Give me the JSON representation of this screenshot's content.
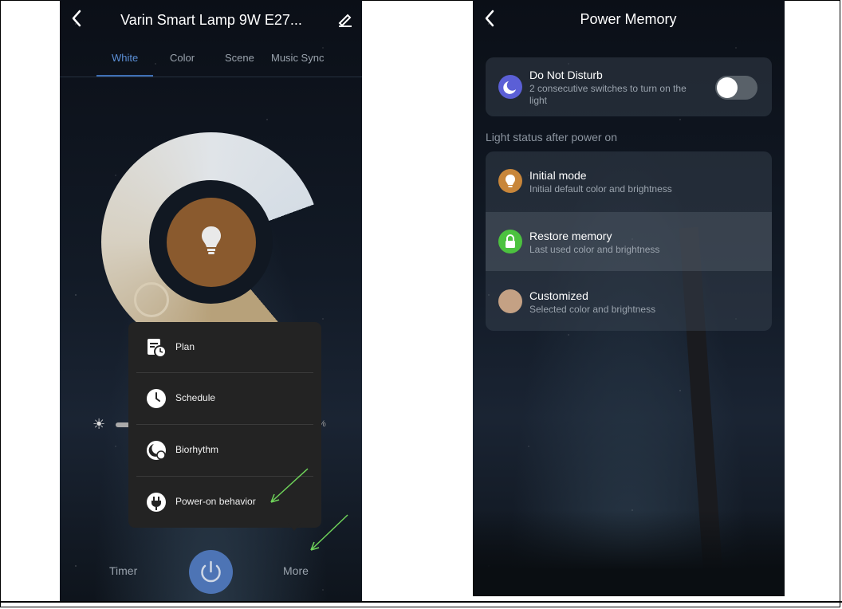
{
  "left_screen": {
    "header": {
      "title": "Varin Smart Lamp 9W E27...",
      "back_icon": "chevron-left-icon",
      "edit_icon": "pencil-icon"
    },
    "tabs": [
      {
        "label": "White",
        "active": true
      },
      {
        "label": "Color",
        "active": false
      },
      {
        "label": "Scene",
        "active": false
      },
      {
        "label": "Music Sync",
        "active": false
      }
    ],
    "brightness": {
      "icon": "sun-icon",
      "percent_text": "%"
    },
    "menu": {
      "items": [
        {
          "label": "Plan",
          "icon": "calendar-clock-icon"
        },
        {
          "label": "Schedule",
          "icon": "clock-icon"
        },
        {
          "label": "Biorhythm",
          "icon": "moon-clock-icon"
        },
        {
          "label": "Power-on behavior",
          "icon": "plug-icon"
        }
      ]
    },
    "bottom": {
      "timer_label": "Timer",
      "more_label": "More",
      "power_icon": "power-icon"
    },
    "annotation_color": "#6fd35a"
  },
  "right_screen": {
    "header": {
      "title": "Power Memory",
      "back_icon": "chevron-left-icon"
    },
    "dnd": {
      "title": "Do Not Disturb",
      "subtitle_line1": "2 consecutive switches to turn on the",
      "subtitle_line2": "light",
      "icon": "moon-icon",
      "toggle_on": false
    },
    "section_label": "Light status after power on",
    "options": [
      {
        "title": "Initial mode",
        "subtitle": "Initial default color and brightness",
        "icon": "bulb-icon",
        "color": "#c8863a"
      },
      {
        "title": "Restore memory",
        "subtitle": "Last used color and brightness",
        "icon": "lock-icon",
        "color": "#4cc23f",
        "selected": true
      },
      {
        "title": "Customized",
        "subtitle": "Selected color and brightness",
        "icon": "color-swatch",
        "color": "#c4a184"
      }
    ]
  }
}
